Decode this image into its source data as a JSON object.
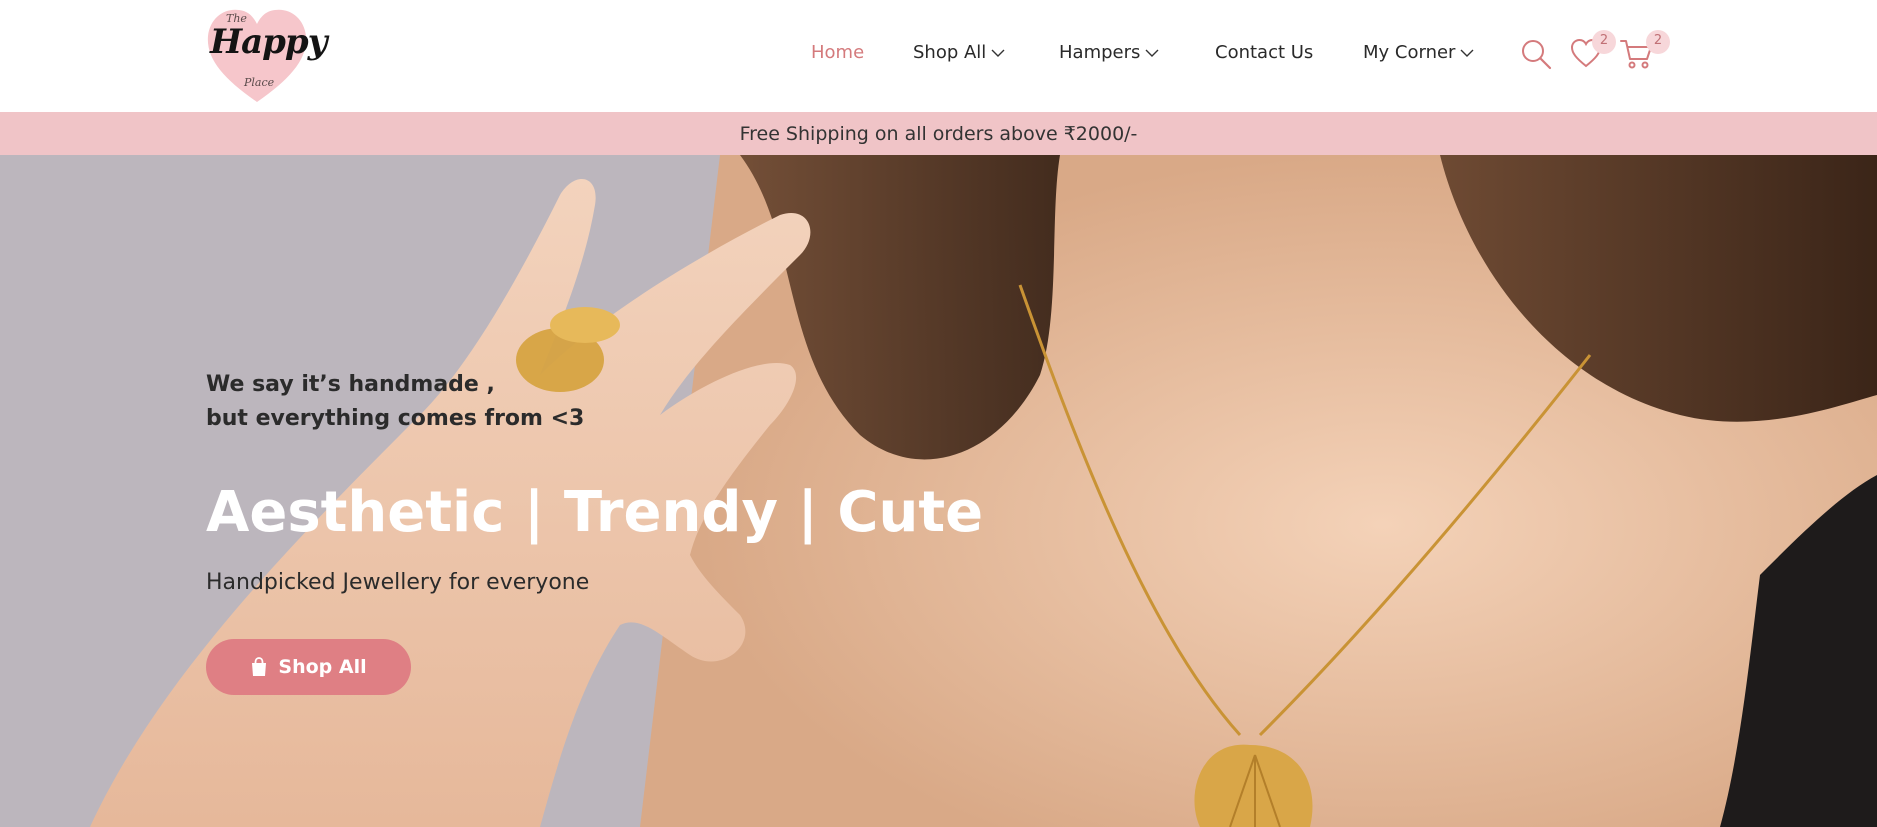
{
  "brand": {
    "logo_words": [
      "The",
      "Happy",
      "Place"
    ],
    "accent_color": "#d47a7c",
    "button_color": "#df7f84",
    "promo_bg_color": "#f0c4c7"
  },
  "nav": {
    "home": "Home",
    "shop_all": "Shop All",
    "hampers": "Hampers",
    "contact": "Contact Us",
    "my_corner": "My Corner"
  },
  "icons": {
    "search": "search-icon",
    "wishlist": "heart-icon",
    "cart": "cart-icon",
    "dropdown": "chevron-down-icon",
    "button": "shopping-bag-icon"
  },
  "counts": {
    "wishlist": "2",
    "cart": "2"
  },
  "promo": {
    "text": "Free Shipping on all orders above ₹2000/-"
  },
  "hero": {
    "tagline_line1": "We say it’s handmade ,",
    "tagline_line2": "but everything comes from <3",
    "title": "Aesthetic | Trendy | Cute",
    "subtitle": "Handpicked Jewellery for everyone",
    "button_label": "Shop All"
  }
}
